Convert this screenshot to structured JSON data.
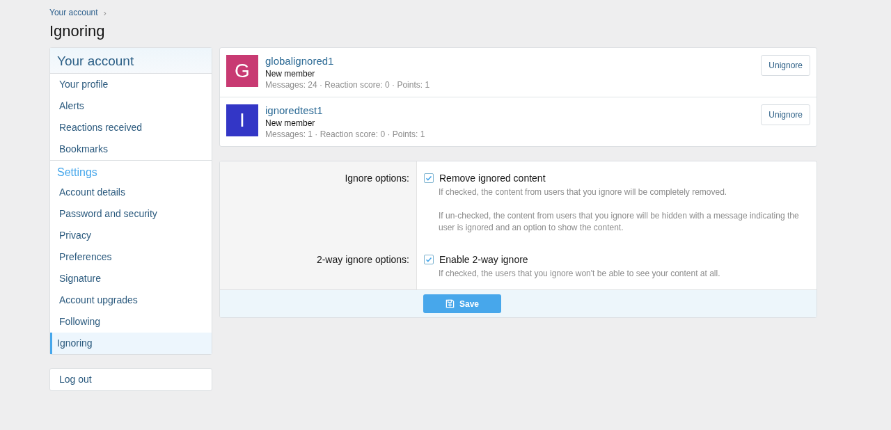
{
  "breadcrumb": [
    {
      "label": "Your account",
      "separator": "›"
    }
  ],
  "page_title": "Ignoring",
  "sidebar": {
    "sections": [
      {
        "heading": "Your account",
        "kind": "main",
        "items": [
          {
            "label": "Your profile",
            "selected": false
          },
          {
            "label": "Alerts",
            "selected": false
          },
          {
            "label": "Reactions received",
            "selected": false
          },
          {
            "label": "Bookmarks",
            "selected": false
          }
        ]
      },
      {
        "heading": "Settings",
        "kind": "sub",
        "items": [
          {
            "label": "Account details",
            "selected": false
          },
          {
            "label": "Password and security",
            "selected": false
          },
          {
            "label": "Privacy",
            "selected": false
          },
          {
            "label": "Preferences",
            "selected": false
          },
          {
            "label": "Signature",
            "selected": false
          },
          {
            "label": "Account upgrades",
            "selected": false
          },
          {
            "label": "Following",
            "selected": false
          },
          {
            "label": "Ignoring",
            "selected": true
          }
        ]
      }
    ],
    "logout": "Log out"
  },
  "ignored_users": [
    {
      "avatar_letter": "G",
      "color": "#c83a72",
      "name": "globalignored1",
      "title": "New member",
      "stats": "Messages: 24 · Reaction score: 0 · Points: 1",
      "button": "Unignore"
    },
    {
      "avatar_letter": "I",
      "color": "#3336c6",
      "name": "ignoredtest1",
      "title": "New member",
      "stats": "Messages: 1 · Reaction score: 0 · Points: 1",
      "button": "Unignore"
    }
  ],
  "options": [
    {
      "label": "Ignore options:",
      "checkbox": "Remove ignored content",
      "checked": true,
      "hints": [
        "If checked, the content from users that you ignore will be completely removed.",
        "If un-checked, the content from users that you ignore will be hidden with a message indicating the user is ignored and an option to show the content."
      ]
    },
    {
      "label": "2-way ignore options:",
      "checkbox": "Enable 2-way ignore",
      "checked": true,
      "hints": [
        "If checked, the users that you ignore won't be able to see your content at all."
      ]
    }
  ],
  "save_button": "Save"
}
